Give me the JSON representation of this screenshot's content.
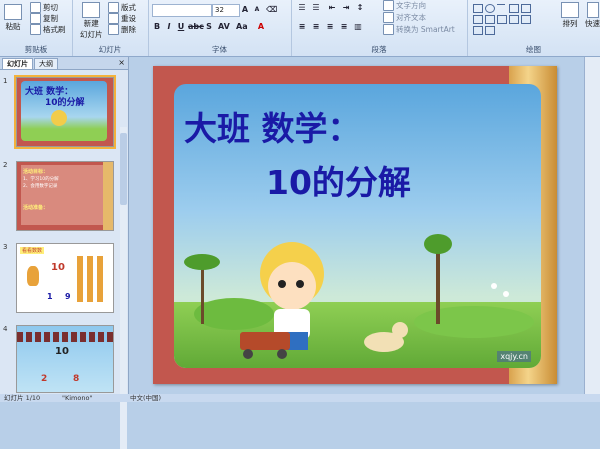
{
  "ribbon": {
    "clipboard": {
      "paste": "粘贴",
      "copy": "复制",
      "format_painter": "格式刷",
      "cut": "剪切",
      "label": "剪贴板"
    },
    "slides": {
      "new_slide": "新建",
      "new_slide2": "幻灯片",
      "layout": "版式",
      "reset": "重设",
      "delete": "删除",
      "label": "幻灯片"
    },
    "font": {
      "size": "32",
      "label": "字体"
    },
    "paragraph": {
      "text_direction": "文字方向",
      "align_text": "对齐文本",
      "smartart": "转换为 SmartArt",
      "label": "段落"
    },
    "drawing": {
      "arrange": "排列",
      "quick_styles": "快速",
      "label": "绘图"
    }
  },
  "left_pane": {
    "tabs": [
      {
        "label": "幻灯片"
      },
      {
        "label": "大纲"
      }
    ],
    "close": "×",
    "slides": [
      {
        "number": "1",
        "title": "大班 数学：",
        "subtitle": "10的分解"
      },
      {
        "number": "2",
        "heading": "活动目标：",
        "line1": "1、学习10的分解",
        "line2": "2、会用数字记录",
        "heading2": "活动准备："
      },
      {
        "number": "3",
        "heading": "看看数数",
        "big": "10",
        "a": "1",
        "b": "9"
      },
      {
        "number": "4",
        "big": "10",
        "a": "2",
        "b": "8"
      }
    ]
  },
  "slide": {
    "title_line1": "大班 数学：",
    "title_line2": "10的分解",
    "watermark": "xqjy.cn"
  },
  "status": {
    "slide_info": "幻灯片 1/10",
    "theme": "\"Kimono\"",
    "language": "中文(中国)"
  },
  "colors": {
    "title": "#1a1aa6",
    "slide_border": "#c2574e"
  }
}
